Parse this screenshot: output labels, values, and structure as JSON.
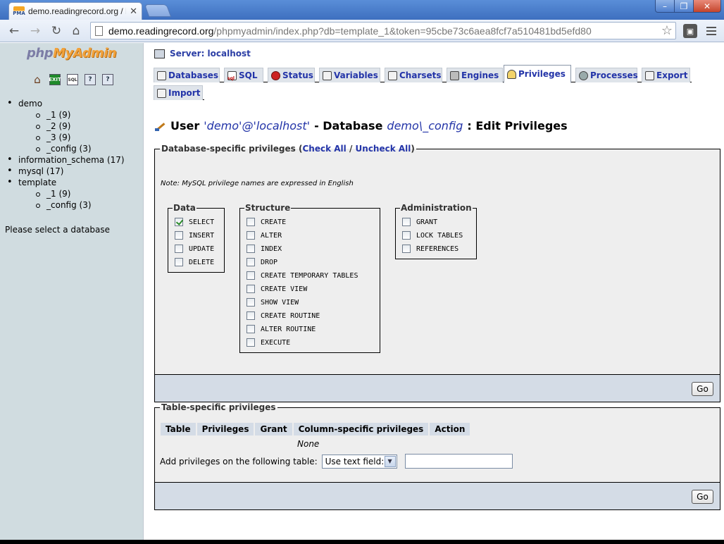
{
  "browser": {
    "tab_title": "demo.readingrecord.org / loc",
    "favicon_text": "PMA",
    "url_host": "demo.readingrecord.org",
    "url_path": "/phpmyadmin/index.php?db=template_1&token=95cbe73c6aea8fcf7a510481bd5efd80"
  },
  "left": {
    "logo_php": "php",
    "logo_myadmin": "MyAdmin",
    "databases": [
      {
        "name": "demo",
        "tables": [
          "_1 (9)",
          "_2 (9)",
          "_3 (9)",
          "_config (3)"
        ]
      },
      {
        "name": "information_schema (17)",
        "tables": []
      },
      {
        "name": "mysql (17)",
        "tables": []
      },
      {
        "name": "template",
        "tables": [
          "_1 (9)",
          "_config (3)"
        ]
      }
    ],
    "message": "Please select a database"
  },
  "server": {
    "label": "Server: localhost"
  },
  "tabs": [
    {
      "label": "Databases",
      "icon": "databases-icon"
    },
    {
      "label": "SQL",
      "icon": "sql-icon"
    },
    {
      "label": "Status",
      "icon": "status-icon"
    },
    {
      "label": "Variables",
      "icon": "variables-icon"
    },
    {
      "label": "Charsets",
      "icon": "charsets-icon"
    },
    {
      "label": "Engines",
      "icon": "engines-icon"
    },
    {
      "label": "Privileges",
      "icon": "privileges-icon",
      "active": true
    },
    {
      "label": "Processes",
      "icon": "processes-icon"
    },
    {
      "label": "Export",
      "icon": "export-icon"
    },
    {
      "label": "Import",
      "icon": "import-icon"
    }
  ],
  "heading": {
    "user_prefix": "User",
    "user": "'demo'@'localhost'",
    "db_prefix": "- Database",
    "db": "demo\\_config",
    "suffix": ": Edit Privileges"
  },
  "db_priv": {
    "legend": "Database-specific privileges",
    "open_paren": "(",
    "check_all": "Check All",
    "slash": "/",
    "uncheck_all": "Uncheck All",
    "close_paren": ")",
    "note": "Note: MySQL privilege names are expressed in English",
    "groups": {
      "data": {
        "legend": "Data",
        "items": [
          {
            "label": "SELECT",
            "checked": true
          },
          {
            "label": "INSERT",
            "checked": false
          },
          {
            "label": "UPDATE",
            "checked": false
          },
          {
            "label": "DELETE",
            "checked": false
          }
        ]
      },
      "structure": {
        "legend": "Structure",
        "items": [
          {
            "label": "CREATE",
            "checked": false
          },
          {
            "label": "ALTER",
            "checked": false
          },
          {
            "label": "INDEX",
            "checked": false
          },
          {
            "label": "DROP",
            "checked": false
          },
          {
            "label": "CREATE TEMPORARY TABLES",
            "checked": false
          },
          {
            "label": "CREATE VIEW",
            "checked": false
          },
          {
            "label": "SHOW VIEW",
            "checked": false
          },
          {
            "label": "CREATE ROUTINE",
            "checked": false
          },
          {
            "label": "ALTER ROUTINE",
            "checked": false
          },
          {
            "label": "EXECUTE",
            "checked": false
          }
        ]
      },
      "administration": {
        "legend": "Administration",
        "items": [
          {
            "label": "GRANT",
            "checked": false
          },
          {
            "label": "LOCK TABLES",
            "checked": false
          },
          {
            "label": "REFERENCES",
            "checked": false
          }
        ]
      }
    },
    "go_label": "Go"
  },
  "table_priv": {
    "legend": "Table-specific privileges",
    "columns": [
      "Table",
      "Privileges",
      "Grant",
      "Column-specific privileges",
      "Action"
    ],
    "empty_text": "None",
    "add_label": "Add privileges on the following table:",
    "select_value": "Use text field:",
    "text_value": "",
    "go_label": "Go"
  }
}
